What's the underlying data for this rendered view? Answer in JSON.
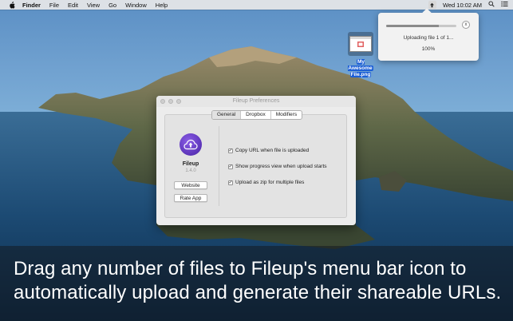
{
  "menubar": {
    "items": [
      "Finder",
      "File",
      "Edit",
      "View",
      "Go",
      "Window",
      "Help"
    ],
    "clock": "Wed 10:02 AM"
  },
  "upload_popover": {
    "status": "Uploading file 1 of 1...",
    "percent": "100%",
    "progress": 0.75,
    "cancel_label": "x"
  },
  "desktop_file": {
    "name_line1": "My Awesome",
    "name_line2": "File.png"
  },
  "prefs_window": {
    "title": "Fileup Preferences",
    "tabs": [
      "General",
      "Dropbox",
      "Modifiers"
    ],
    "active_tab": "General",
    "app_name": "Fileup",
    "version": "1.4.0",
    "website_button": "Website",
    "rate_button": "Rate App",
    "options": [
      {
        "label": "Copy URL when file is uploaded",
        "checked": true
      },
      {
        "label": "Show progress view when upload starts",
        "checked": true
      },
      {
        "label": "Upload as zip for multiple files",
        "checked": true
      }
    ]
  },
  "caption": {
    "line1": "Drag any number of files to Fileup's menu bar icon to",
    "line2": "automatically upload and generate their shareable URLs."
  },
  "colors": {
    "accent": "#1c5fd6",
    "app_icon": "#6a43cc"
  }
}
